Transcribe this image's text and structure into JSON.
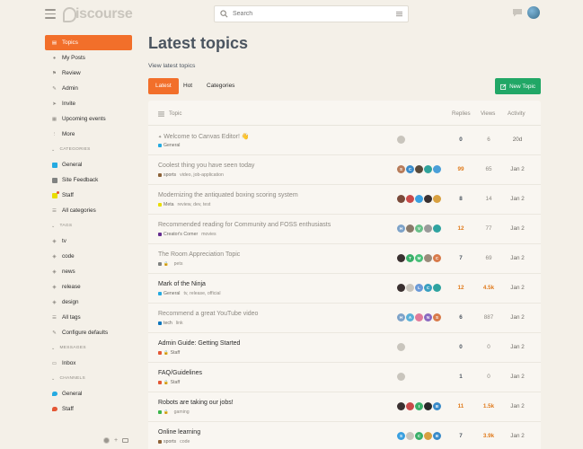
{
  "header": {
    "logo_text": "iscourse",
    "search_placeholder": "Search"
  },
  "sidebar": {
    "top_items": [
      {
        "label": "Topics",
        "icon": "layers-icon",
        "active": true
      },
      {
        "label": "My Posts",
        "icon": "user-icon"
      },
      {
        "label": "Review",
        "icon": "flag-icon"
      },
      {
        "label": "Admin",
        "icon": "wrench-icon"
      },
      {
        "label": "Invite",
        "icon": "paper-plane-icon"
      },
      {
        "label": "Upcoming events",
        "icon": "calendar-icon"
      },
      {
        "label": "More",
        "icon": "ellipsis-icon"
      }
    ],
    "categories_label": "Categories",
    "categories": [
      {
        "label": "General",
        "color": "#25aae1"
      },
      {
        "label": "Site Feedback",
        "color": "#808281"
      },
      {
        "label": "Staff",
        "color": "#e9dd00",
        "locked": true
      },
      {
        "label": "All categories",
        "icon": "list-icon"
      }
    ],
    "tags_label": "Tags",
    "tags": [
      {
        "label": "tv"
      },
      {
        "label": "code"
      },
      {
        "label": "news"
      },
      {
        "label": "release"
      },
      {
        "label": "design"
      },
      {
        "label": "All tags",
        "icon": "list-icon"
      },
      {
        "label": "Configure defaults",
        "icon": "wrench-icon"
      }
    ],
    "messages_label": "Messages",
    "messages": [
      {
        "label": "Inbox"
      }
    ],
    "channels_label": "Channels",
    "channels": [
      {
        "label": "General",
        "color": "#25aae1"
      },
      {
        "label": "Staff",
        "color": "#e45735"
      }
    ]
  },
  "main": {
    "title": "Latest topics",
    "subtitle": "View latest topics",
    "tabs": [
      "Latest",
      "Hot",
      "Categories"
    ],
    "new_topic_label": "New Topic",
    "columns": {
      "topic": "Topic",
      "replies": "Replies",
      "views": "Views",
      "activity": "Activity"
    }
  },
  "topics": [
    {
      "title": "Welcome to Canvas Editor! 👋",
      "pinned": true,
      "read": true,
      "category": "General",
      "cat_color": "#25aae1",
      "tags": "",
      "posters": [
        {
          "l": "",
          "c": "#c9c5bd"
        }
      ],
      "replies": "0",
      "views": "6",
      "activity": "20d"
    },
    {
      "title": "Coolest thing you have seen today",
      "read": true,
      "category": "sports",
      "cat_color": "#8c6238",
      "tags": "video, job-application",
      "posters": [
        {
          "l": "S",
          "c": "#b87c5a"
        },
        {
          "l": "C",
          "c": "#3a8bc9"
        },
        {
          "l": "",
          "c": "#5a4a3a"
        },
        {
          "l": "",
          "c": "#2fa39b"
        },
        {
          "l": "",
          "c": "#4a9fd8"
        }
      ],
      "replies": "99",
      "replies_hot": true,
      "views": "65",
      "activity": "Jan 2"
    },
    {
      "title": "Modernizing the antiquated boxing scoring system",
      "read": true,
      "category": "Meta",
      "cat_color": "#e9dd00",
      "tags": "review, dev, test",
      "posters": [
        {
          "l": "",
          "c": "#7a4a3a"
        },
        {
          "l": "",
          "c": "#c94a4a"
        },
        {
          "l": "",
          "c": "#3aa0e0"
        },
        {
          "l": "",
          "c": "#3a3030"
        },
        {
          "l": "",
          "c": "#d8a040"
        }
      ],
      "replies": "8",
      "views": "14",
      "activity": "Jan 2"
    },
    {
      "title": "Recommended reading for Community and FOSS enthusiasts",
      "read": true,
      "category": "Creator's Corner",
      "cat_color": "#652d90",
      "tags": "movies",
      "posters": [
        {
          "l": "H",
          "c": "#7ea3c9"
        },
        {
          "l": "",
          "c": "#8a7a6a"
        },
        {
          "l": "V",
          "c": "#6ac08a"
        },
        {
          "l": "",
          "c": "#9a9a9a"
        },
        {
          "l": "",
          "c": "#2fa3a0"
        }
      ],
      "replies": "12",
      "replies_hot": true,
      "views": "77",
      "activity": "Jan 2"
    },
    {
      "title": "The Room Appreciation Topic",
      "read": true,
      "category": "",
      "cat_color": "#808281",
      "locked": true,
      "tags": "pets",
      "posters": [
        {
          "l": "",
          "c": "#3a3030"
        },
        {
          "l": "T",
          "c": "#3ab06a"
        },
        {
          "l": "M",
          "c": "#4ac07a"
        },
        {
          "l": "",
          "c": "#9a8a7a"
        },
        {
          "l": "C",
          "c": "#d87a4a"
        }
      ],
      "replies": "7",
      "views": "69",
      "activity": "Jan 2"
    },
    {
      "title": "Mark of the Ninja",
      "read": false,
      "category": "General",
      "cat_color": "#25aae1",
      "tags": "tv, release, official",
      "posters": [
        {
          "l": "",
          "c": "#3a3030"
        },
        {
          "l": "",
          "c": "#c9c5bd"
        },
        {
          "l": "L",
          "c": "#6a9ad8"
        },
        {
          "l": "C",
          "c": "#3aa0c0"
        },
        {
          "l": "",
          "c": "#2fa3a0"
        }
      ],
      "replies": "12",
      "replies_hot": true,
      "views": "4.5k",
      "views_hot": true,
      "activity": "Jan 2"
    },
    {
      "title": "Recommend a great YouTube video",
      "read": true,
      "category": "tech",
      "cat_color": "#0e76bd",
      "tags": "link",
      "posters": [
        {
          "l": "H",
          "c": "#7ea3c9"
        },
        {
          "l": "A",
          "c": "#5ab0d8"
        },
        {
          "l": "",
          "c": "#e07a9a"
        },
        {
          "l": "N",
          "c": "#8a6ac0"
        },
        {
          "l": "S",
          "c": "#d87a4a"
        }
      ],
      "replies": "6",
      "views": "887",
      "activity": "Jan 2"
    },
    {
      "title": "Admin Guide: Getting Started",
      "read": false,
      "category": "Staff",
      "cat_color": "#e45735",
      "locked": true,
      "tags": "",
      "posters": [
        {
          "l": "",
          "c": "#c9c5bd"
        }
      ],
      "replies": "0",
      "views": "0",
      "activity": "Jan 2"
    },
    {
      "title": "FAQ/Guidelines",
      "read": false,
      "category": "Staff",
      "cat_color": "#e45735",
      "locked": true,
      "tags": "",
      "posters": [
        {
          "l": "",
          "c": "#c9c5bd"
        }
      ],
      "replies": "1",
      "views": "0",
      "activity": "Jan 2"
    },
    {
      "title": "Robots are taking our jobs!",
      "read": false,
      "category": "",
      "cat_color": "#3ab54a",
      "locked": true,
      "tags": "gaming",
      "posters": [
        {
          "l": "",
          "c": "#3a3030"
        },
        {
          "l": "",
          "c": "#c94a4a"
        },
        {
          "l": "I",
          "c": "#3ab06a"
        },
        {
          "l": "",
          "c": "#2a2a2a"
        },
        {
          "l": "B",
          "c": "#3a8bc9"
        }
      ],
      "replies": "11",
      "replies_hot": true,
      "views": "1.5k",
      "views_hot": true,
      "activity": "Jan 2"
    },
    {
      "title": "Online learning",
      "read": false,
      "category": "sports",
      "cat_color": "#8c6238",
      "tags": "code",
      "posters": [
        {
          "l": "S",
          "c": "#3aa0e0"
        },
        {
          "l": "",
          "c": "#c9c5bd"
        },
        {
          "l": "C",
          "c": "#3ab06a"
        },
        {
          "l": "",
          "c": "#d8a040"
        },
        {
          "l": "B",
          "c": "#3a8bc9"
        }
      ],
      "replies": "7",
      "views": "3.9k",
      "views_hot": true,
      "activity": "Jan 2"
    }
  ]
}
